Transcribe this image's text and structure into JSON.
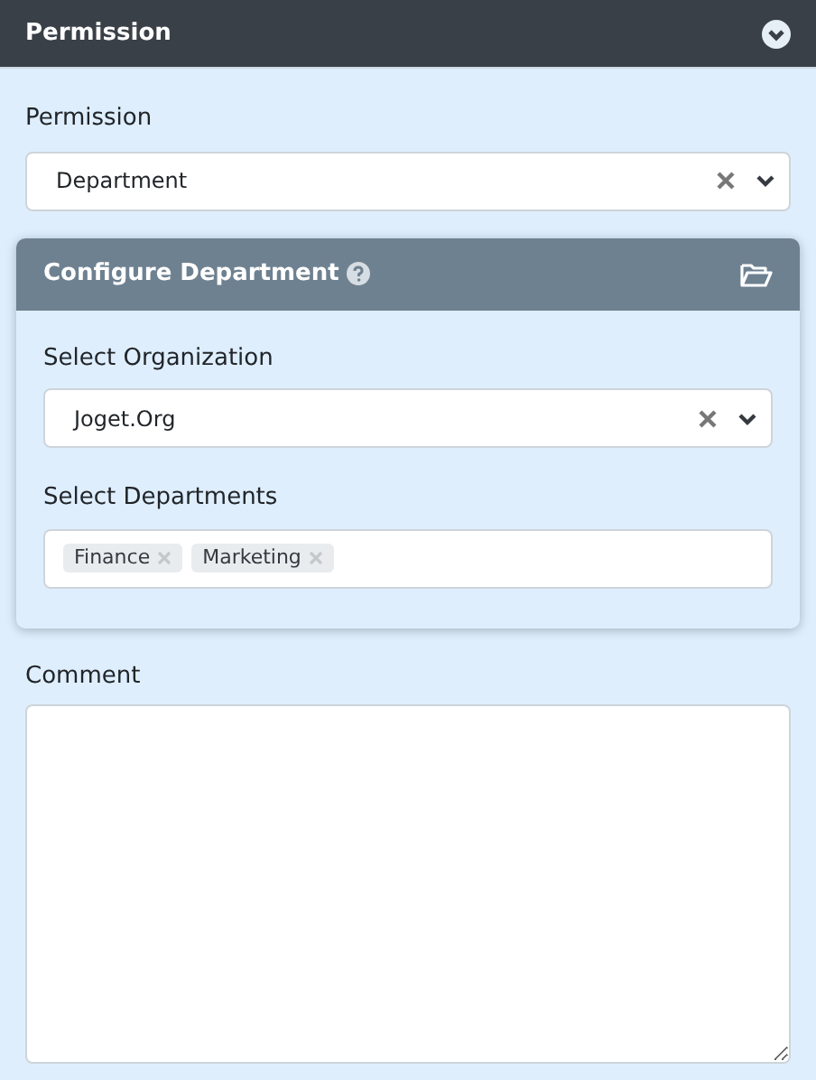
{
  "header": {
    "title": "Permission"
  },
  "permission": {
    "label": "Permission",
    "value": "Department"
  },
  "card": {
    "title": "Configure Department",
    "organization": {
      "label": "Select Organization",
      "value": "Joget.Org"
    },
    "departments": {
      "label": "Select Departments",
      "tags": [
        "Finance",
        "Marketing"
      ]
    }
  },
  "comment": {
    "label": "Comment"
  }
}
